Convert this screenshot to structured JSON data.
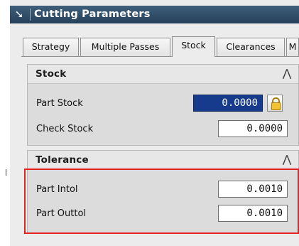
{
  "window": {
    "title": "Cutting Parameters"
  },
  "tabs": [
    "Strategy",
    "Multiple Passes",
    "Stock",
    "Clearances",
    "M"
  ],
  "active_tab": "Stock",
  "stock_section": {
    "title": "Stock",
    "collapse_icon": "chevron-up-icon",
    "rows": [
      {
        "label": "Part Stock",
        "value": "0.0000"
      },
      {
        "label": "Check Stock",
        "value": "0.0000"
      }
    ]
  },
  "tolerance_section": {
    "title": "Tolerance",
    "collapse_icon": "chevron-up-icon",
    "rows": [
      {
        "label": "Part Intol",
        "value": "0.0010"
      },
      {
        "label": "Part Outtol",
        "value": "0.0010"
      }
    ]
  },
  "colors": {
    "highlight": "#e52222",
    "selected_field": "#163a8c",
    "titlebar": "#2e4a66"
  }
}
